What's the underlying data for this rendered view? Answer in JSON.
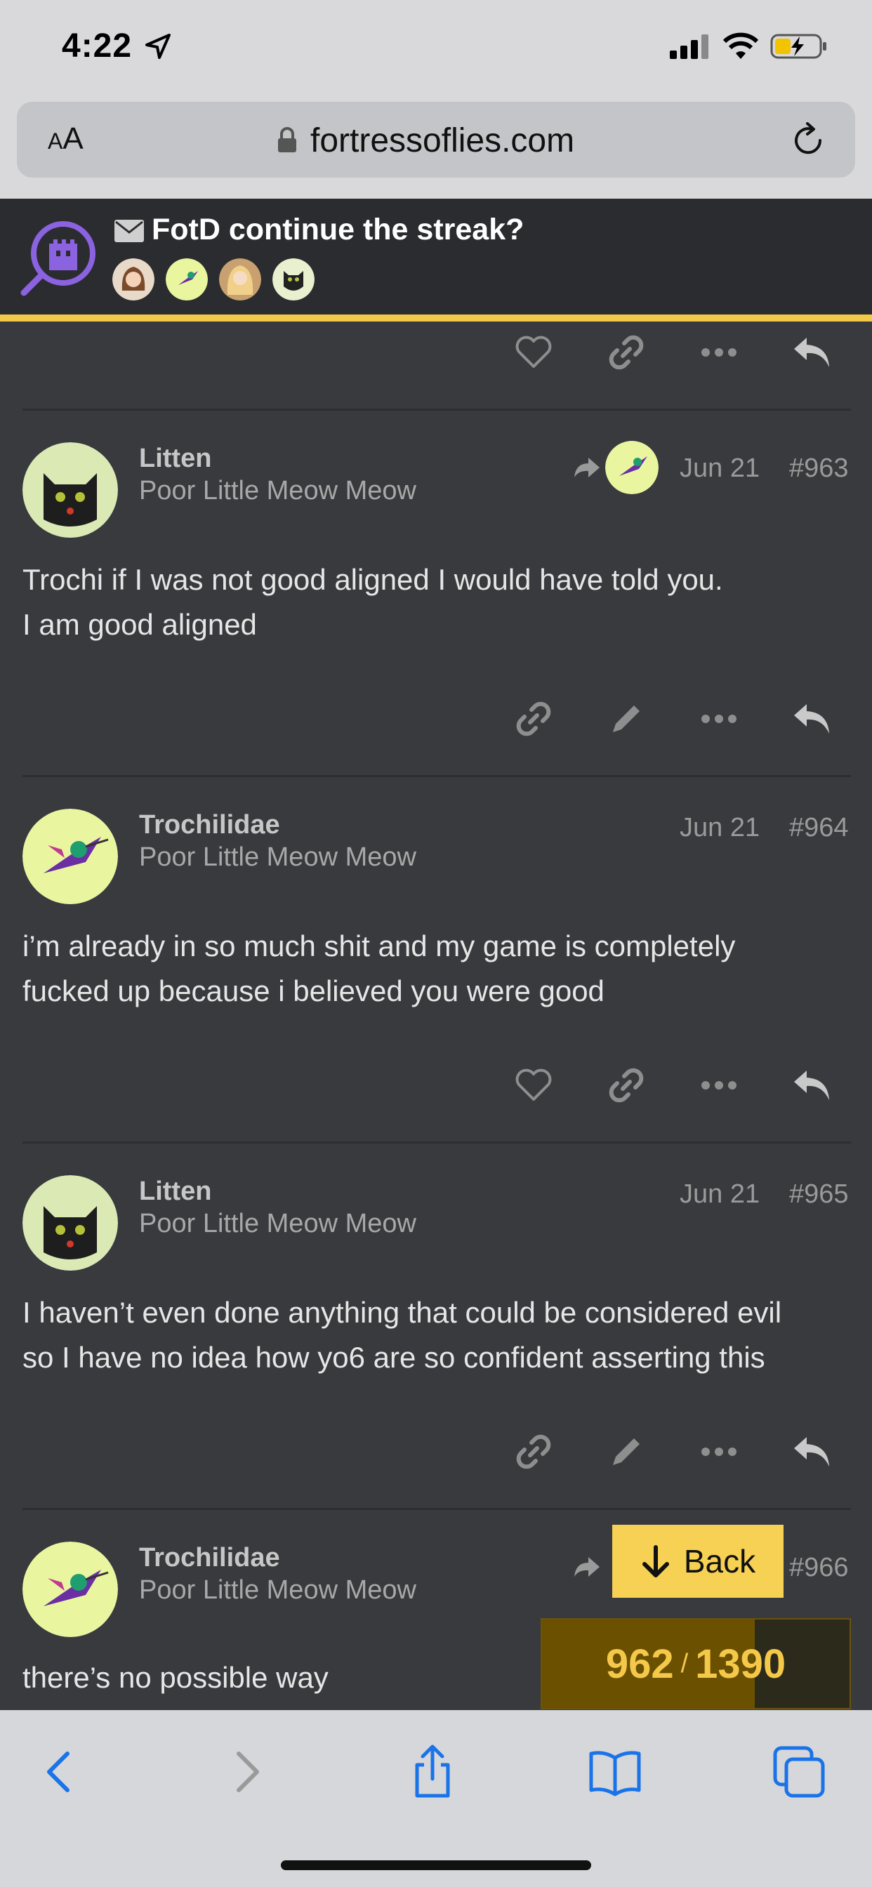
{
  "status": {
    "time": "4:22"
  },
  "browser": {
    "url": "fortressoflies.com",
    "aa_small": "A",
    "aa_large": "A"
  },
  "topic": {
    "title": "FotD continue the streak?",
    "participants": [
      "avatar-girl",
      "avatar-hummingbird",
      "avatar-blonde",
      "avatar-cat"
    ]
  },
  "posts": [
    {
      "username": "Litten",
      "user_title": "Poor Little Meow Meow",
      "date": "Jun 21",
      "number": "#963",
      "avatar": "black-cat",
      "reply_to_avatar": "hummingbird",
      "body_lines": [
        "Trochi if I was not good aligned I would have told you.",
        "I am good aligned"
      ]
    },
    {
      "username": "Trochilidae",
      "user_title": "Poor Little Meow Meow",
      "date": "Jun 21",
      "number": "#964",
      "avatar": "hummingbird",
      "body_lines": [
        "i’m already in so much shit and my game is completely",
        "fucked up because i believed you were good"
      ]
    },
    {
      "username": "Litten",
      "user_title": "Poor Little Meow Meow",
      "date": "Jun 21",
      "number": "#965",
      "avatar": "black-cat",
      "body_lines": [
        "I haven’t even done anything that could be considered evil",
        "so I have no idea how yo6 are so confident asserting this"
      ]
    },
    {
      "username": "Trochilidae",
      "user_title": "Poor Little Meow Meow",
      "number": "#966",
      "avatar": "hummingbird",
      "body_lines": [
        "there’s no possible way"
      ]
    }
  ],
  "back_button": {
    "label": "Back"
  },
  "progress": {
    "current": "962",
    "separator": "/",
    "total": "1390",
    "fraction": 0.6921
  },
  "colors": {
    "accent": "#f4c94a",
    "background": "#393a3e",
    "header": "#2b2c30"
  }
}
